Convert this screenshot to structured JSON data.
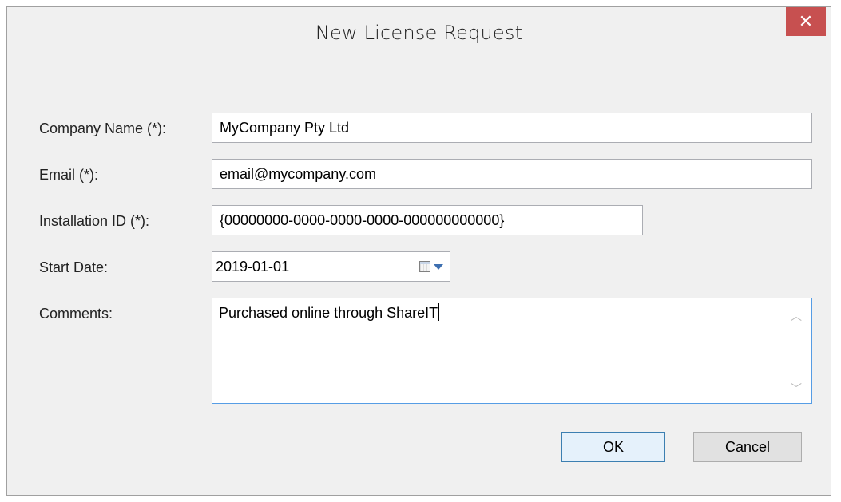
{
  "dialog": {
    "title": "New License Request",
    "close_symbol": "✕"
  },
  "form": {
    "company_label": "Company Name (*):",
    "company_value": "MyCompany Pty Ltd",
    "email_label": "Email (*):",
    "email_value": "email@mycompany.com",
    "installation_label": "Installation ID (*):",
    "installation_value": "{00000000-0000-0000-0000-000000000000}",
    "start_date_label": "Start Date:",
    "start_date_value": "2019-01-01",
    "comments_label": "Comments:",
    "comments_value": "Purchased online through ShareIT"
  },
  "buttons": {
    "ok": "OK",
    "cancel": "Cancel"
  },
  "icons": {
    "calendar": "calendar-icon",
    "dropdown": "chevron-down-icon",
    "scroll_up": "scroll-up-icon",
    "scroll_down": "scroll-down-icon",
    "close": "close-icon"
  },
  "colors": {
    "close_button": "#c75050",
    "focus_border": "#569de5",
    "default_button_border": "#3c7fb1"
  }
}
